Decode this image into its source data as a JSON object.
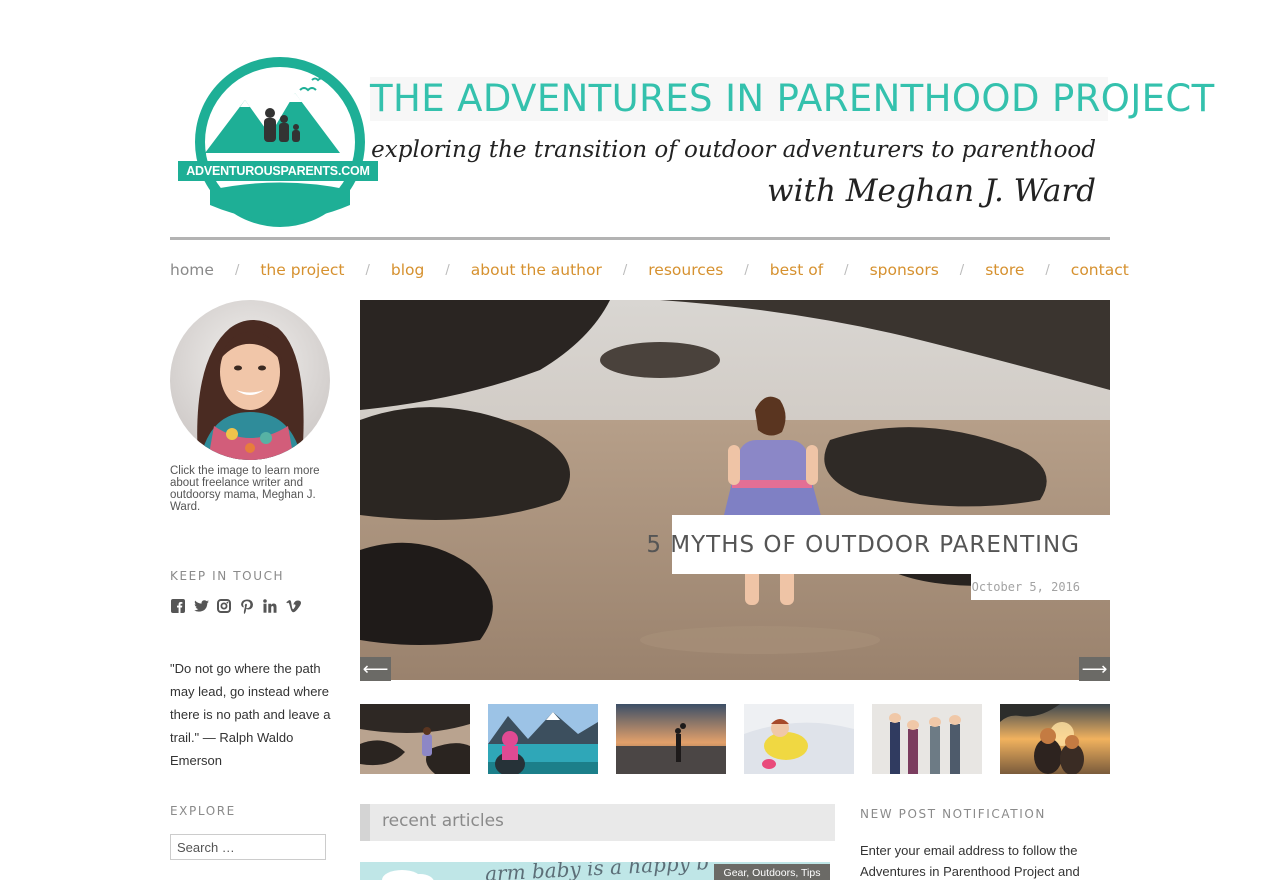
{
  "header": {
    "logo_text": "ADVENTUROUSPARENTS.COM",
    "site_title": "THE ADVENTURES IN PARENTHOOD PROJECT",
    "tagline_line1": "exploring the transition of outdoor adventurers to parenthood",
    "tagline_line2": "with Meghan J. Ward",
    "brand_color": "#1eaf96"
  },
  "nav": {
    "items": [
      {
        "label": "home"
      },
      {
        "label": "the project"
      },
      {
        "label": "blog"
      },
      {
        "label": "about the author"
      },
      {
        "label": "resources"
      },
      {
        "label": "best of"
      },
      {
        "label": "sponsors"
      },
      {
        "label": "store"
      },
      {
        "label": "contact"
      }
    ],
    "separator": "/",
    "link_color": "#d6912f"
  },
  "sidebar": {
    "avatar_caption": "Click the image to learn more about freelance writer and outdoorsy mama, Meghan J. Ward.",
    "keep_in_touch_heading": "KEEP IN TOUCH",
    "social_icons": [
      "facebook-icon",
      "twitter-icon",
      "instagram-icon",
      "pinterest-icon",
      "linkedin-icon",
      "vimeo-icon"
    ],
    "quote": "\"Do not go where the path may lead, go instead where there is no path and leave a trail.\" — Ralph Waldo Emerson",
    "explore_heading": "EXPLORE",
    "search_placeholder": "Search …"
  },
  "slider": {
    "title": "5 MYTHS OF OUTDOOR PARENTING",
    "date": "October 5, 2016",
    "prev_symbol": "⟵",
    "next_symbol": "⟶"
  },
  "recent": {
    "heading": "recent articles",
    "image_text": "arm baby is a happy b",
    "tags": [
      "Gear",
      "Outdoors",
      "Tips"
    ]
  },
  "notification": {
    "heading": "NEW POST NOTIFICATION",
    "text": "Enter your email address to follow the Adventures in Parenthood Project and"
  }
}
